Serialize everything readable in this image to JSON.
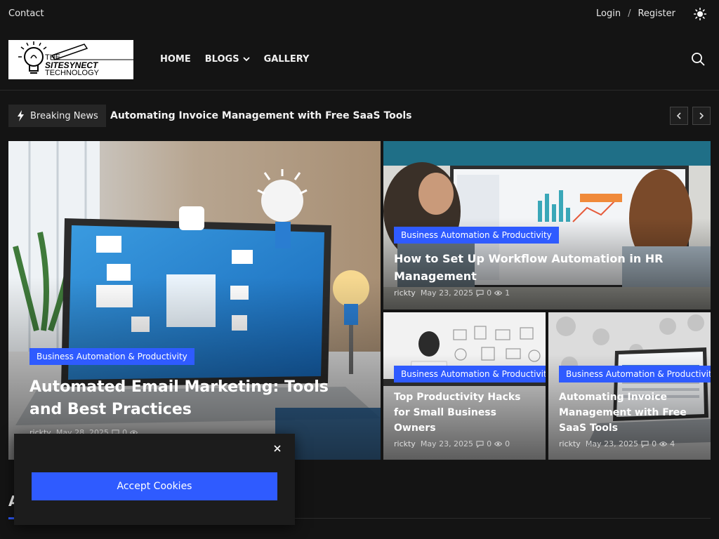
{
  "topbar": {
    "contact": "Contact",
    "login": "Login",
    "separator": "/",
    "register": "Register",
    "theme_icon": "sun-icon"
  },
  "header": {
    "logo": {
      "line1": "THE",
      "line2": "SITESYNECT",
      "line3": "TECHNOLOGY"
    },
    "nav": [
      {
        "label": "HOME"
      },
      {
        "label": "BLOGS",
        "dropdown": true
      },
      {
        "label": "GALLERY"
      }
    ],
    "search_icon": "search-icon"
  },
  "breaking": {
    "label": "Breaking News",
    "headline": "Automating Invoice Management with Free SaaS Tools",
    "prev_icon": "chevron-left-icon",
    "next_icon": "chevron-right-icon"
  },
  "featured": [
    {
      "category": "Business Automation & Productivity",
      "title": "Automated Email Marketing: Tools and Best Practices",
      "author": "rickty",
      "date": "May 28, 2025",
      "comments": "0",
      "views": ""
    },
    {
      "category": "Business Automation & Productivity",
      "title": "How to Set Up Workflow Automation in HR Management",
      "author": "rickty",
      "date": "May 23, 2025",
      "comments": "0",
      "views": "1"
    },
    {
      "category": "Business Automation & Productivity",
      "title": "Top Productivity Hacks for Small Business Owners",
      "author": "rickty",
      "date": "May 23, 2025",
      "comments": "0",
      "views": "0"
    },
    {
      "category": "Business Automation & Productivity",
      "title": "Automating Invoice Management with Free SaaS Tools",
      "author": "rickty",
      "date": "May 23, 2025",
      "comments": "0",
      "views": "4"
    }
  ],
  "section": {
    "title": "A"
  },
  "cookie": {
    "button": "Accept Cookies",
    "close_icon": "close-icon"
  },
  "colors": {
    "accent": "#2f5bff",
    "background": "#141414"
  }
}
